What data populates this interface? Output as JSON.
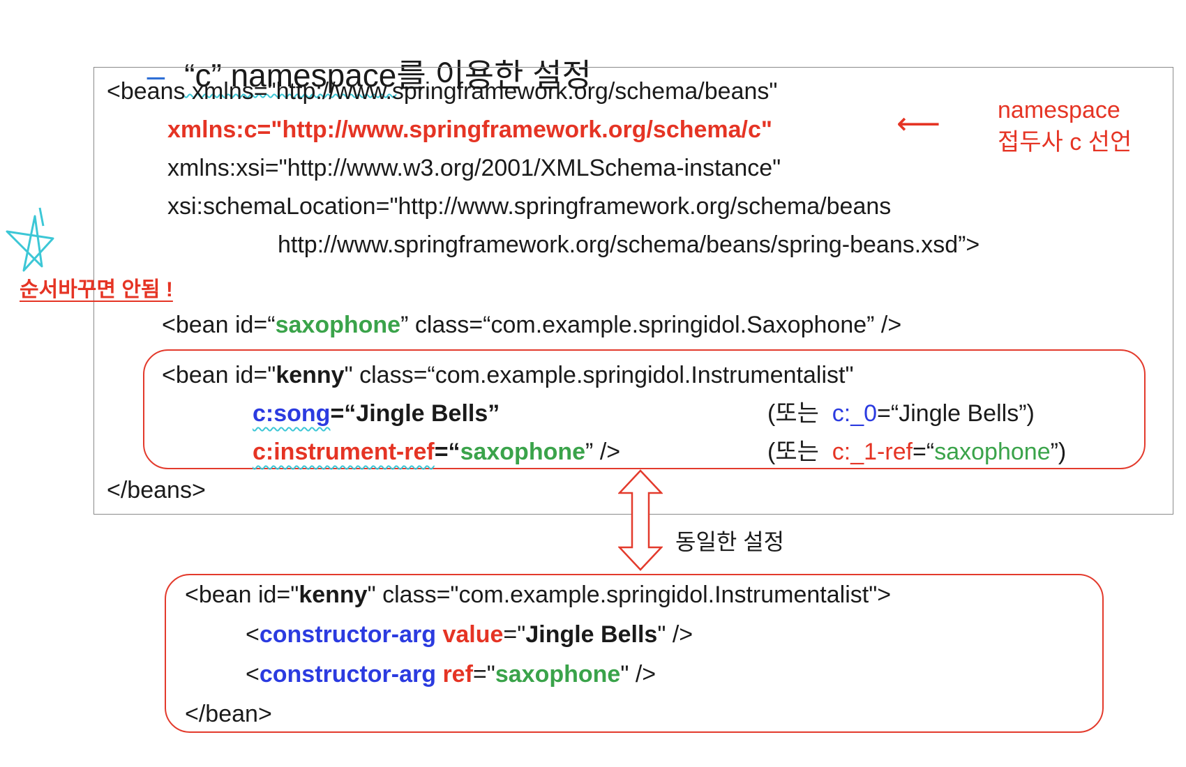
{
  "title": {
    "dash": "–",
    "en": "“c” namespace",
    "ko": "를 이용한 설정"
  },
  "main_code": {
    "l1": "<beans xmlns=\"http://www.springframework.org/schema/beans\"",
    "l2": "xmlns:c=\"http://www.springframework.org/schema/c\"",
    "l3": "xmlns:xsi=\"http://www.w3.org/2001/XMLSchema-instance\"",
    "l4": "xsi:schemaLocation=\"http://www.springframework.org/schema/beans",
    "l5": "http://www.springframework.org/schema/beans/spring-beans.xsd”>",
    "sax_a": "<bean id=“",
    "sax_id": "saxophone",
    "sax_b": "” class=“com.example.springidol.Saxophone” />",
    "closing": "</beans>"
  },
  "kenny_c": {
    "a": "<bean id=\"",
    "id": "kenny",
    "b": "\" class=“com.example.springidol.Instrumentalist\"",
    "song_attr": "c:song",
    "song_eq": "=“Jingle Bells”",
    "instr_attr": "c:instrument-ref",
    "instr_eq": "=“",
    "instr_val": "saxophone",
    "instr_end": "” />",
    "alt1_prefix": "(또는  ",
    "alt1_attr": "c:_0",
    "alt1_rest": "=“Jingle Bells”)",
    "alt2_prefix": "(또는  ",
    "alt2_attr": "c:_1-ref",
    "alt2_eq": "=“",
    "alt2_val": "saxophone",
    "alt2_end": "”)"
  },
  "annotation": {
    "line1": "namespace",
    "line2": "접두사 c 선언",
    "arrow": "⟵"
  },
  "order_note": "순서바꾸면 안됨 !",
  "same_label": "동일한 설정",
  "kenny_ctor": {
    "a": "<bean id=\"",
    "id": "kenny",
    "b": "\" class=\"com.example.springidol.Instrumentalist\">",
    "lt1": "<",
    "tag1": "constructor-arg",
    "attr1": "value",
    "eq1": "=\"",
    "val1": "Jingle Bells",
    "end1": "\" />",
    "lt2": "<",
    "tag2": "constructor-arg",
    "attr2": "ref",
    "eq2": "=\"",
    "val2": "saxophone",
    "end2": "\" />",
    "closing": "</bean>"
  },
  "colors": {
    "red": "#e53424",
    "green": "#3aa34a",
    "blue": "#2b3be0",
    "cyan": "#3cc7d6"
  }
}
